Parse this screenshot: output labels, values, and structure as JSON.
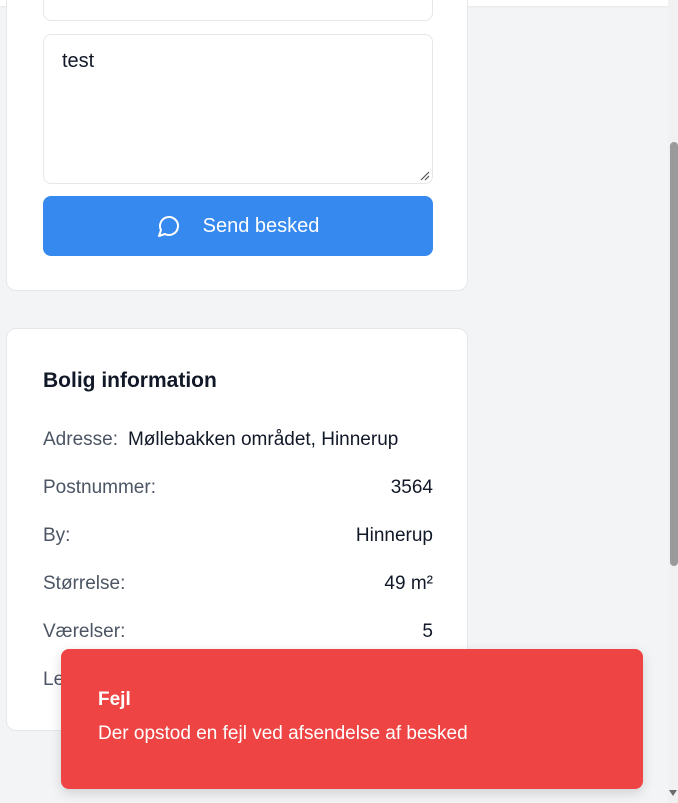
{
  "contact_form": {
    "message_value": "test",
    "send_label": "Send besked"
  },
  "property_info": {
    "title": "Bolig information",
    "rows": [
      {
        "label": "Adresse:",
        "value": "Møllebakken området, Hinnerup"
      },
      {
        "label": "Postnummer:",
        "value": "3564"
      },
      {
        "label": "By:",
        "value": "Hinnerup"
      },
      {
        "label": "Størrelse:",
        "value": "49 m²"
      },
      {
        "label": "Værelser:",
        "value": "5"
      },
      {
        "label": "Le",
        "value": ""
      }
    ]
  },
  "toast": {
    "title": "Fejl",
    "message": "Der opstod en fejl ved afsendelse af besked",
    "color": "#ef4444"
  },
  "colors": {
    "primary": "#3689ef",
    "error": "#ef4444"
  },
  "icons": {
    "send_button": "chat-bubble-icon"
  }
}
